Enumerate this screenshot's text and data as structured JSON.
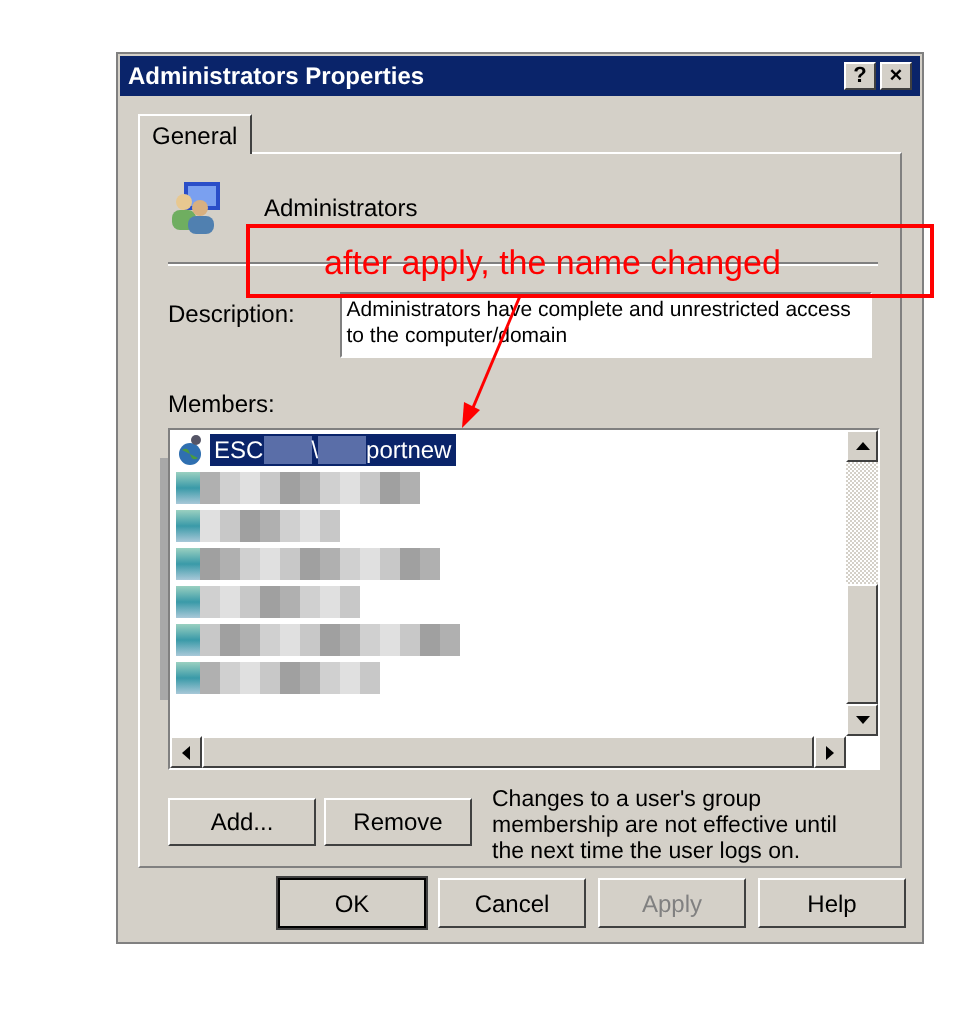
{
  "window": {
    "title": "Administrators Properties",
    "title_buttons": [
      "?",
      "×"
    ]
  },
  "tabs": [
    {
      "label": "General",
      "selected": true
    }
  ],
  "group_name": "Administrators",
  "description": {
    "label": "Description:",
    "value": "Administrators have complete and unrestricted access to the computer/domain"
  },
  "members": {
    "label": "Members:",
    "items": [
      {
        "kind": "account",
        "parts": [
          "ESC",
          "\\",
          "portnew"
        ],
        "selected": true
      },
      {
        "kind": "blurred",
        "selected": false
      },
      {
        "kind": "blurred",
        "selected": false
      },
      {
        "kind": "blurred",
        "selected": false
      },
      {
        "kind": "blurred",
        "selected": false
      },
      {
        "kind": "blurred",
        "selected": false
      },
      {
        "kind": "blurred",
        "selected": false
      }
    ]
  },
  "member_buttons": [
    {
      "label": "Add...",
      "disabled": false
    },
    {
      "label": "Remove",
      "disabled": false
    }
  ],
  "note": "Changes to a user's group membership are not effective until the next time the user logs on.",
  "buttons": [
    {
      "label": "OK",
      "default": true,
      "disabled": false
    },
    {
      "label": "Cancel",
      "default": false,
      "disabled": false
    },
    {
      "label": "Apply",
      "default": false,
      "disabled": true
    },
    {
      "label": "Help",
      "default": false,
      "disabled": false
    }
  ],
  "annotation": {
    "text": "after apply, the name changed"
  }
}
